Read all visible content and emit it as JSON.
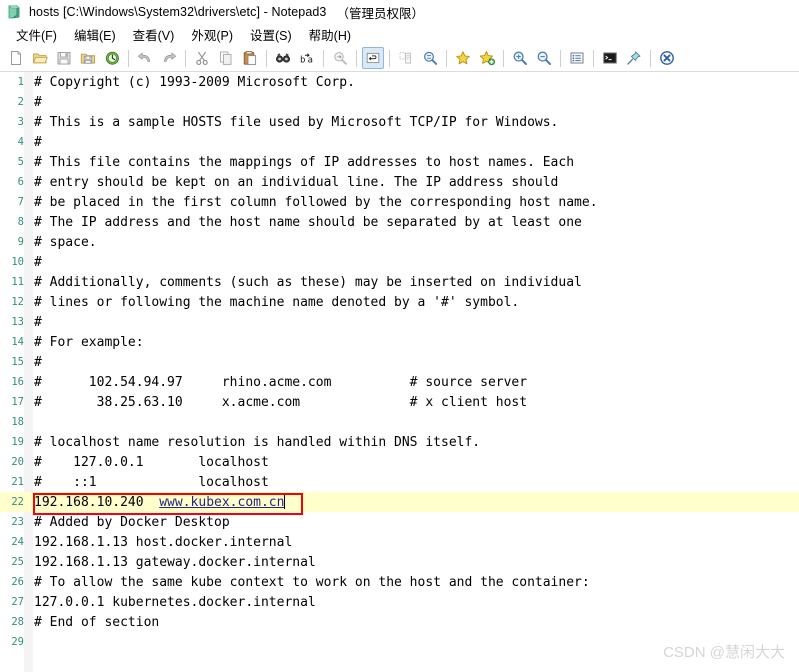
{
  "window": {
    "icon": "notepad3-app-icon",
    "title": "hosts [C:\\Windows\\System32\\drivers\\etc] - Notepad3",
    "title_suffix": "（管理员权限）"
  },
  "menubar": {
    "items": [
      {
        "label": "文件(F)",
        "name": "menu-file"
      },
      {
        "label": "编辑(E)",
        "name": "menu-edit"
      },
      {
        "label": "查看(V)",
        "name": "menu-view"
      },
      {
        "label": "外观(P)",
        "name": "menu-appearance"
      },
      {
        "label": "设置(S)",
        "name": "menu-settings"
      },
      {
        "label": "帮助(H)",
        "name": "menu-help"
      }
    ]
  },
  "toolbar": {
    "buttons": [
      {
        "name": "new-file-icon",
        "title": "新建"
      },
      {
        "name": "open-file-icon",
        "title": "打开"
      },
      {
        "name": "save-file-icon",
        "title": "保存"
      },
      {
        "name": "save-as-icon",
        "title": "另存为"
      },
      {
        "name": "reload-file-icon",
        "title": "重新载入"
      },
      {
        "name": "undo-icon",
        "title": "撤销"
      },
      {
        "name": "redo-icon",
        "title": "重做"
      },
      {
        "name": "cut-icon",
        "title": "剪切"
      },
      {
        "name": "copy-icon",
        "title": "复制"
      },
      {
        "name": "paste-icon",
        "title": "粘贴"
      },
      {
        "name": "find-icon",
        "title": "查找"
      },
      {
        "name": "replace-icon",
        "title": "替换"
      },
      {
        "name": "find-next-icon",
        "title": "查找下一个"
      },
      {
        "name": "word-wrap-icon",
        "title": "自动换行",
        "active": true
      },
      {
        "name": "show-whitespace-icon",
        "title": "显示空白字符"
      },
      {
        "name": "zoom-selection-icon",
        "title": "查找选中内容"
      },
      {
        "name": "bookmark-icon",
        "title": "书签"
      },
      {
        "name": "add-bookmark-icon",
        "title": "添加书签"
      },
      {
        "name": "zoom-in-icon",
        "title": "放大"
      },
      {
        "name": "zoom-out-icon",
        "title": "缩小"
      },
      {
        "name": "document-outline-icon",
        "title": "大纲视图"
      },
      {
        "name": "console-icon",
        "title": "控制台"
      },
      {
        "name": "pin-on-top-icon",
        "title": "置顶"
      },
      {
        "name": "close-file-icon",
        "title": "关闭"
      }
    ]
  },
  "editor": {
    "highlight_line": 22,
    "highlight_color": "#ffffcc",
    "annotation_box_color": "#fc0000",
    "line_number_color": "#2f8f7f",
    "url_color": "#26267e",
    "lines": [
      {
        "n": 1,
        "text": "# Copyright (c) 1993-2009 Microsoft Corp."
      },
      {
        "n": 2,
        "text": "#"
      },
      {
        "n": 3,
        "text": "# This is a sample HOSTS file used by Microsoft TCP/IP for Windows."
      },
      {
        "n": 4,
        "text": "#"
      },
      {
        "n": 5,
        "text": "# This file contains the mappings of IP addresses to host names. Each"
      },
      {
        "n": 6,
        "text": "# entry should be kept on an individual line. The IP address should"
      },
      {
        "n": 7,
        "text": "# be placed in the first column followed by the corresponding host name."
      },
      {
        "n": 8,
        "text": "# The IP address and the host name should be separated by at least one"
      },
      {
        "n": 9,
        "text": "# space."
      },
      {
        "n": 10,
        "text": "#"
      },
      {
        "n": 11,
        "text": "# Additionally, comments (such as these) may be inserted on individual"
      },
      {
        "n": 12,
        "text": "# lines or following the machine name denoted by a '#' symbol."
      },
      {
        "n": 13,
        "text": "#"
      },
      {
        "n": 14,
        "text": "# For example:"
      },
      {
        "n": 15,
        "text": "#"
      },
      {
        "n": 16,
        "text": "#      102.54.94.97     rhino.acme.com          # source server"
      },
      {
        "n": 17,
        "text": "#       38.25.63.10     x.acme.com              # x client host"
      },
      {
        "n": 18,
        "text": ""
      },
      {
        "n": 19,
        "text": "# localhost name resolution is handled within DNS itself."
      },
      {
        "n": 20,
        "text": "#    127.0.0.1       localhost"
      },
      {
        "n": 21,
        "text": "#    ::1             localhost"
      },
      {
        "n": 22,
        "text": "192.168.10.240  www.kubex.com.cn",
        "prefix": "192.168.10.240  ",
        "url": "www.kubex.com.cn",
        "caret": true
      },
      {
        "n": 23,
        "text": "# Added by Docker Desktop"
      },
      {
        "n": 24,
        "text": "192.168.1.13 host.docker.internal"
      },
      {
        "n": 25,
        "text": "192.168.1.13 gateway.docker.internal"
      },
      {
        "n": 26,
        "text": "# To allow the same kube context to work on the host and the container:"
      },
      {
        "n": 27,
        "text": "127.0.0.1 kubernetes.docker.internal"
      },
      {
        "n": 28,
        "text": "# End of section"
      },
      {
        "n": 29,
        "text": ""
      }
    ]
  },
  "watermark": {
    "text": "CSDN @慧闲大大"
  }
}
